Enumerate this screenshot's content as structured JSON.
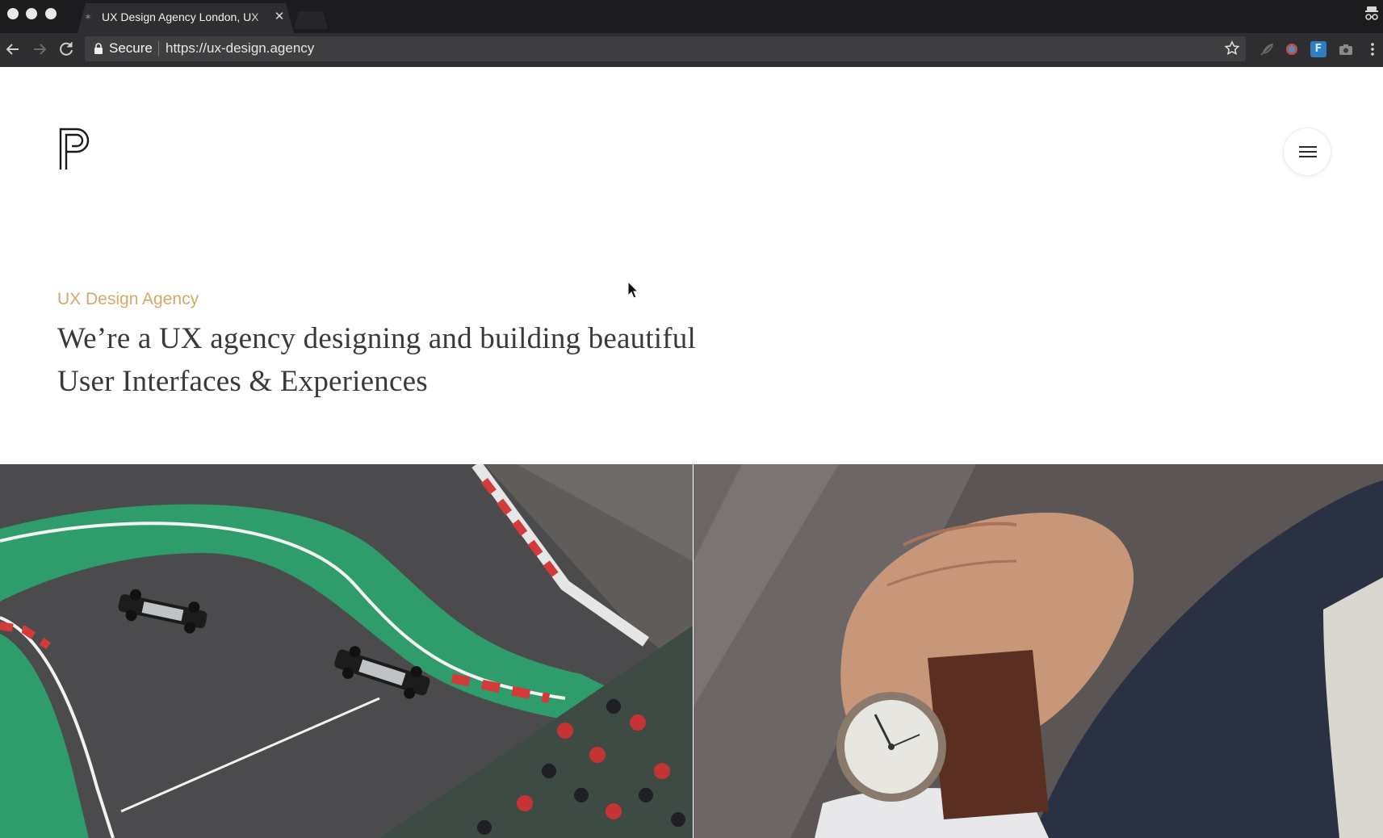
{
  "browser": {
    "tab_title": "UX Design Agency London, UX",
    "secure_label": "Secure",
    "url": "https://ux-design.agency",
    "extension_f_label": "F"
  },
  "site": {
    "eyebrow": "UX Design Agency",
    "headline_line1": "We’re a UX agency designing and building beautiful",
    "headline_line2": "User Interfaces & Experiences"
  },
  "colors": {
    "accent": "#d4a86a",
    "headline": "#3a3a3a",
    "chrome_bg": "#2e2e30",
    "track_green": "#2e9c6b"
  },
  "icons": {
    "logo": "p-monogram-logo",
    "menu": "hamburger-menu-icon",
    "back": "arrow-left-icon",
    "forward": "arrow-right-icon",
    "reload": "reload-icon",
    "lock": "lock-icon",
    "bookmark": "star-icon"
  }
}
